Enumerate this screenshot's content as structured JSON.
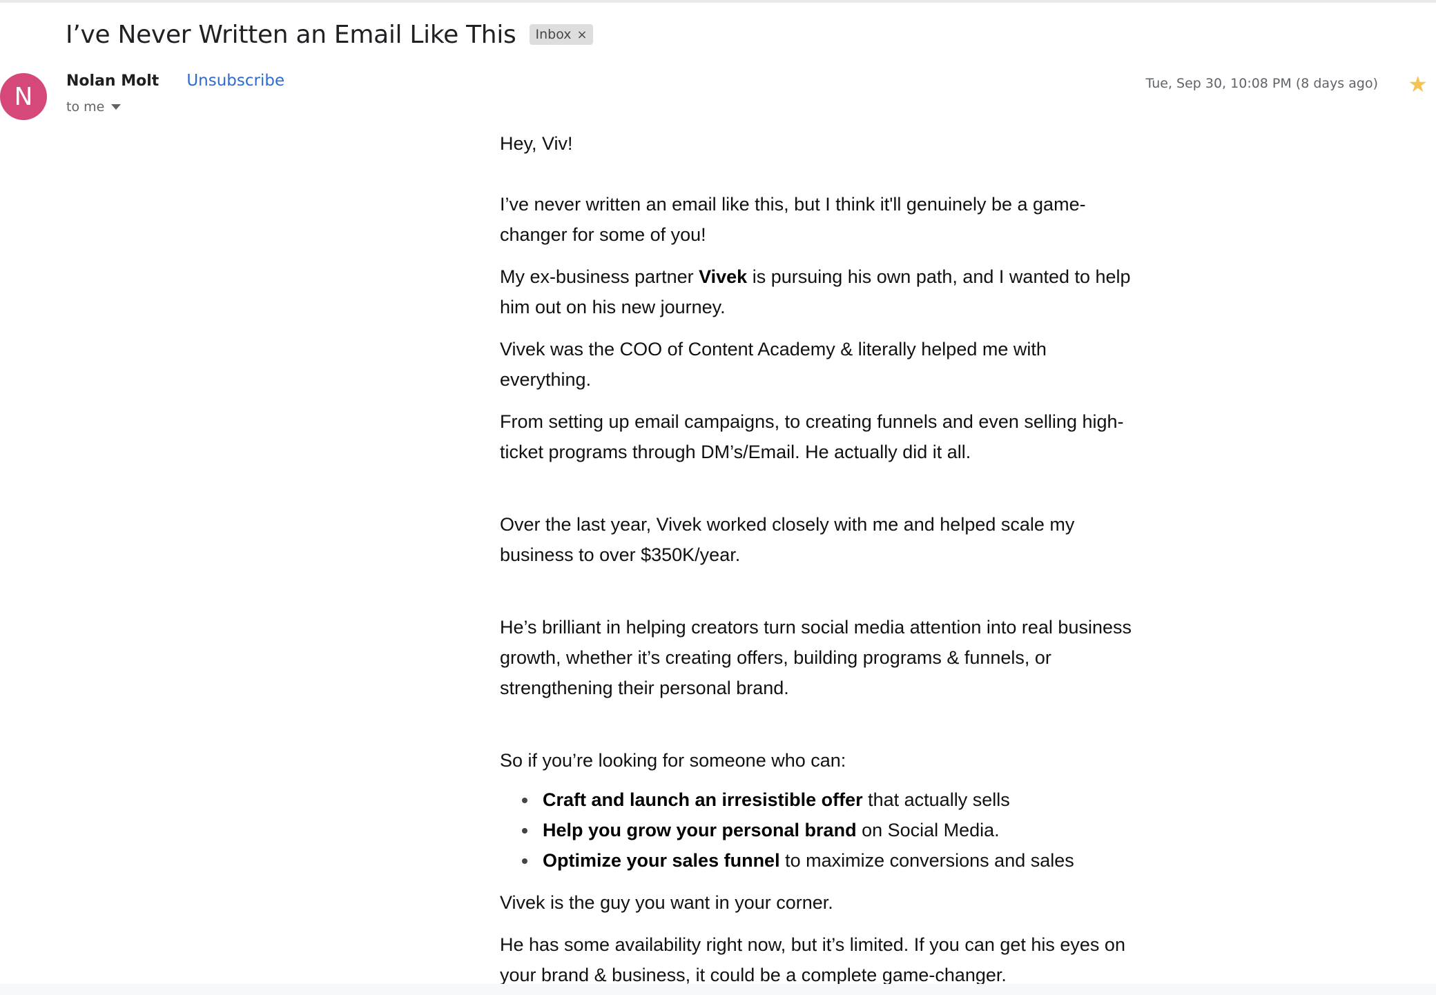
{
  "email": {
    "subject": "I’ve Never Written an Email Like This",
    "label": "Inbox",
    "label_remove": "×",
    "sender": {
      "initial": "N",
      "name": "Nolan Molt",
      "unsubscribe": "Unsubscribe",
      "to": "to me"
    },
    "date": "Tue, Sep 30, 10:08 PM (8 days ago)",
    "star": "★",
    "colors": {
      "avatar": "#d6487a",
      "link": "#2d6bd4",
      "star": "#f4c351"
    },
    "body": {
      "greeting": "Hey, Viv!",
      "p1": "I’ve never written an email like this, but I think it'll genuinely be a game-changer for some of you!",
      "p2_before": "My ex-business partner ",
      "p2_bold": "Vivek",
      "p2_after": " is pursuing his own path, and I wanted to help him out on his new journey.",
      "p3": "Vivek was the COO of Content Academy & literally helped me with everything.",
      "p4": "From setting up email campaigns, to creating funnels and even selling high-ticket programs through DM’s/Email. He actually did it all.",
      "p5": "Over the last year, Vivek worked closely with me and helped scale my business to over $350K/year.",
      "p6": "He’s brilliant in helping creators turn social media attention into real business growth, whether it’s creating offers, building programs & funnels, or strengthening their personal brand.",
      "p7": "So if you’re looking for someone who can:",
      "bullets": [
        {
          "bold": "Craft and launch an irresistible offer",
          "rest": " that actually sells"
        },
        {
          "bold": "Help you grow your personal brand",
          "rest": " on Social Media."
        },
        {
          "bold": "Optimize your sales funnel",
          "rest": " to maximize conversions and sales"
        }
      ],
      "p8": "Vivek is the guy you want in your corner.",
      "p9": "He has some availability right now, but it’s limited. If you can get his eyes on your brand & business, it could be a complete game-changer."
    }
  }
}
